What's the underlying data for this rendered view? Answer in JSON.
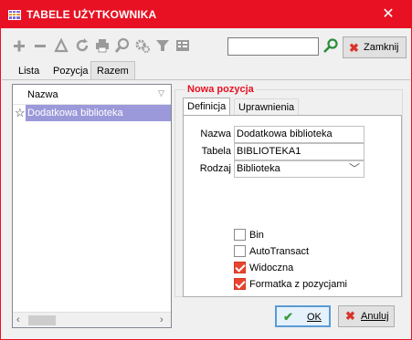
{
  "window": {
    "title": "TABELE UŻYTKOWNIKA"
  },
  "toolbar": {
    "search_value": "",
    "close_label": "Zamknij"
  },
  "top_tabs": [
    "Lista",
    "Pozycja",
    "Razem"
  ],
  "list": {
    "column": "Nazwa",
    "rows": [
      {
        "name": "Dodatkowa biblioteka"
      }
    ]
  },
  "group": {
    "title": "Nowa pozycja"
  },
  "inner_tabs": [
    "Definicja",
    "Uprawnienia"
  ],
  "form": {
    "nazwa_label": "Nazwa",
    "nazwa_value": "Dodatkowa biblioteka",
    "tabela_label": "Tabela",
    "tabela_value": "BIBLIOTEKA1",
    "rodzaj_label": "Rodzaj",
    "rodzaj_value": "Biblioteka"
  },
  "checkboxes": [
    {
      "label": "Bin",
      "checked": false
    },
    {
      "label": "AutoTransact",
      "checked": false
    },
    {
      "label": "Widoczna",
      "checked": true
    },
    {
      "label": "Formatka z pozycjami",
      "checked": true
    }
  ],
  "buttons": {
    "ok": "OK",
    "cancel": "Anuluj"
  },
  "colors": {
    "accent": "#e81123",
    "selection": "#9c99da",
    "check": "#e8442f"
  }
}
